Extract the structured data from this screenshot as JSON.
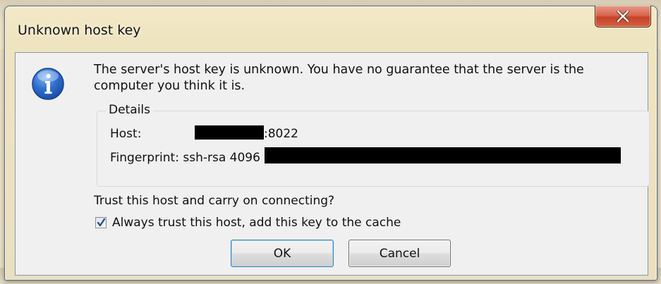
{
  "window": {
    "title": "Unknown host key",
    "close_icon": "close-x-icon"
  },
  "message": {
    "icon": "info-icon",
    "text": "The server's host key is unknown. You have no guarantee that the server is the computer you think it is."
  },
  "details": {
    "legend": "Details",
    "host_label": "Host:",
    "host_port": ":8022",
    "fingerprint_label": "Fingerprint: ssh-rsa 4096"
  },
  "question": "Trust this host and carry on connecting?",
  "checkbox": {
    "label": "Always trust this host, add this key to the cache",
    "checked": true
  },
  "buttons": {
    "ok": "OK",
    "cancel": "Cancel"
  }
}
